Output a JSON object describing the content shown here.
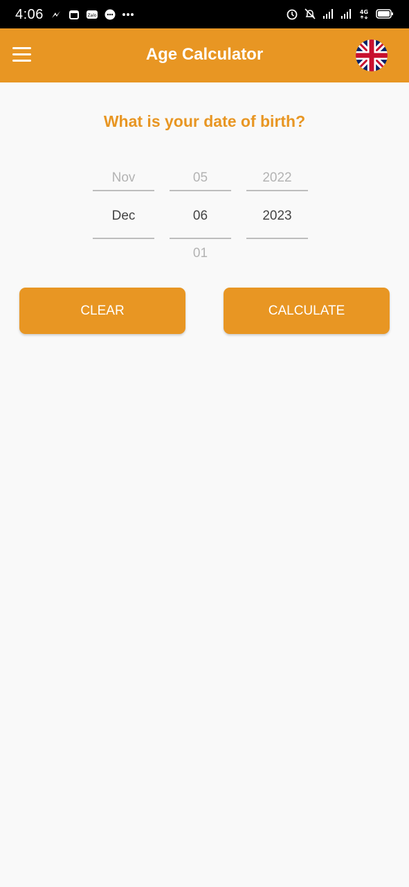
{
  "status_bar": {
    "time": "4:06",
    "left_icons": [
      "messenger-icon",
      "calendar-icon",
      "zalo-icon",
      "chat-icon",
      "more-dots-icon"
    ],
    "right_icons": [
      "alarm-icon",
      "notifications-off-icon",
      "signal-icon",
      "signal-icon",
      "4g-icon",
      "battery-icon"
    ]
  },
  "app_bar": {
    "title": "Age Calculator",
    "menu_icon": "hamburger-menu-icon",
    "language_icon": "uk-flag-icon",
    "background": "#e89623"
  },
  "question": "What is your date of birth?",
  "date_picker": {
    "month": {
      "prev": "Nov",
      "current": "Dec",
      "next": ""
    },
    "day": {
      "prev": "05",
      "current": "06",
      "next": "01"
    },
    "year": {
      "prev": "2022",
      "current": "2023",
      "next": ""
    }
  },
  "buttons": {
    "clear": "CLEAR",
    "calculate": "CALCULATE"
  },
  "colors": {
    "accent": "#e89623",
    "background": "#f9f9f9"
  }
}
